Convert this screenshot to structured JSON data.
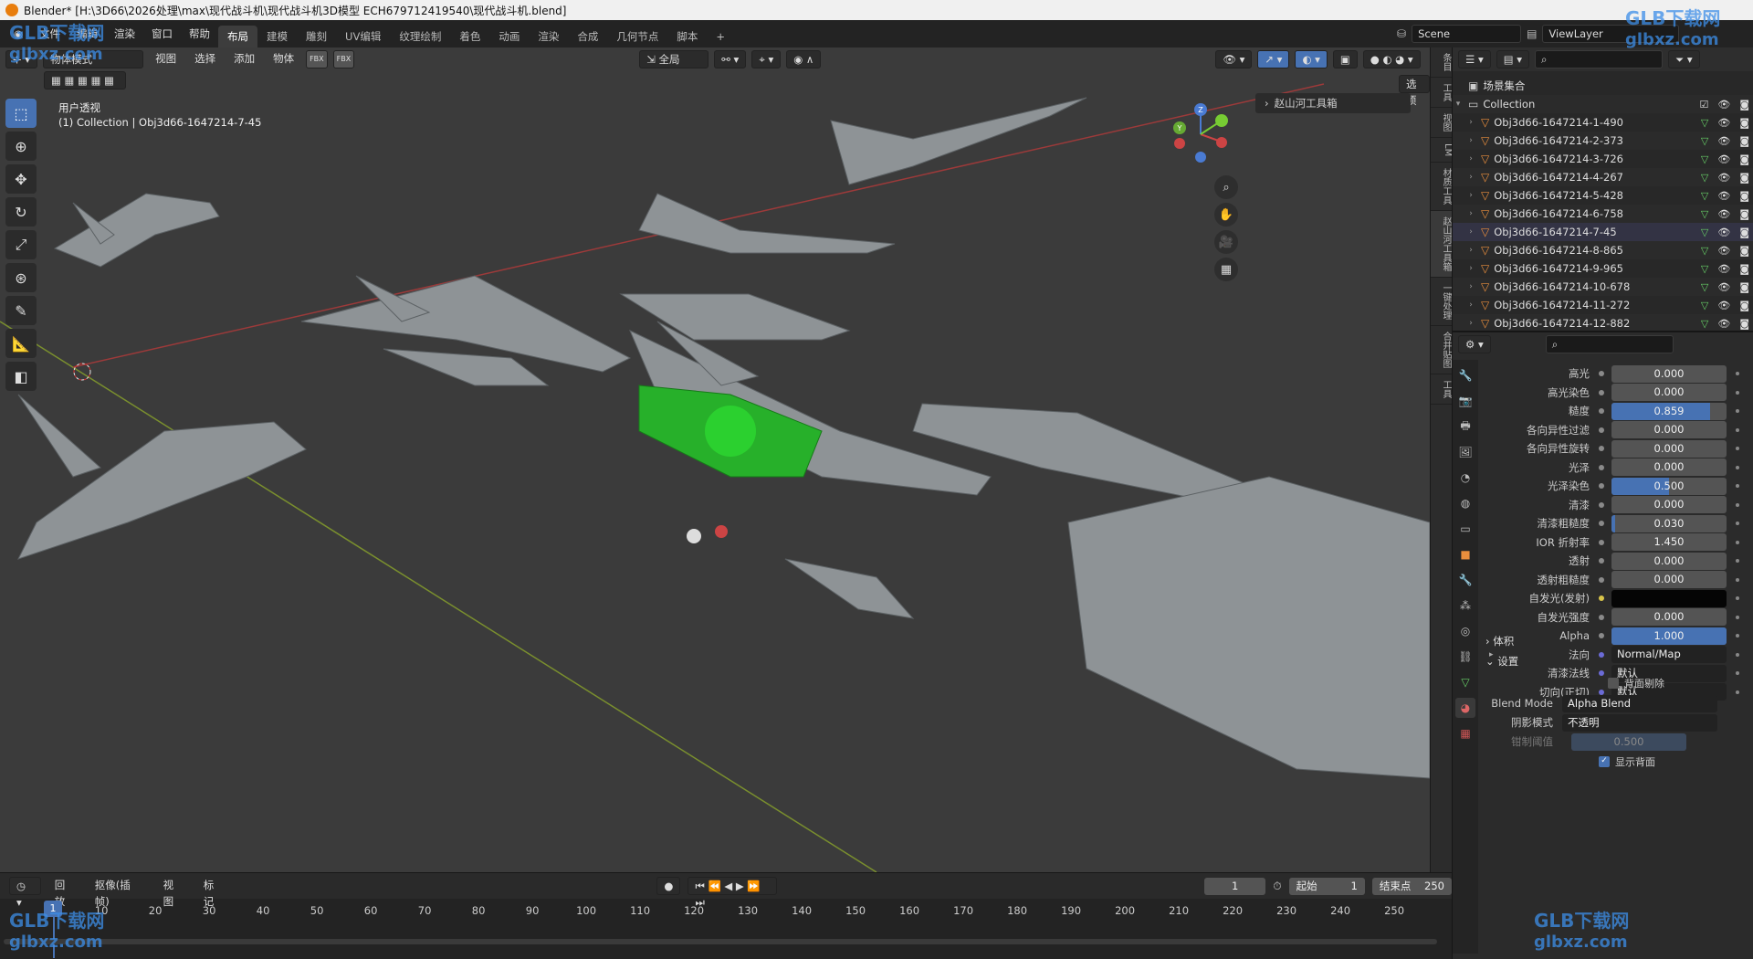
{
  "window": {
    "title": "Blender* [H:\\3D66\\2026处理\\max\\现代战斗机\\现代战斗机3D模型 ECH679712419540\\现代战斗机.blend]"
  },
  "menu": [
    "文件",
    "编辑",
    "渲染",
    "窗口",
    "帮助"
  ],
  "workspaces": [
    "布局",
    "建模",
    "雕刻",
    "UV编辑",
    "纹理绘制",
    "着色",
    "动画",
    "渲染",
    "合成",
    "几何节点",
    "脚本"
  ],
  "workspace_active": "布局",
  "add_tab": "+",
  "scene": {
    "label": "Scene",
    "view_layer": "ViewLayer"
  },
  "viewport": {
    "mode": "物体模式",
    "menus": [
      "视图",
      "选择",
      "添加",
      "物体"
    ],
    "badges": [
      "FBX",
      "FBX"
    ],
    "orientation": "全局",
    "options": "选项",
    "view_name": "用户透视",
    "collection_info": "(1) Collection | Obj3d66-1647214-7-45",
    "toolbox": "赵山河工具箱",
    "gizmo": {
      "x": "X",
      "y": "Y",
      "z": "Z"
    }
  },
  "ntabs": [
    "条目",
    "工具",
    "视图",
    "LM",
    "材质工具",
    "赵山河工具箱",
    "一键处理",
    "合并贴图",
    "工具"
  ],
  "outliner": {
    "root": "场景集合",
    "collection": "Collection",
    "items": [
      "Obj3d66-1647214-1-490",
      "Obj3d66-1647214-2-373",
      "Obj3d66-1647214-3-726",
      "Obj3d66-1647214-4-267",
      "Obj3d66-1647214-5-428",
      "Obj3d66-1647214-6-758",
      "Obj3d66-1647214-7-45",
      "Obj3d66-1647214-8-865",
      "Obj3d66-1647214-9-965",
      "Obj3d66-1647214-10-678",
      "Obj3d66-1647214-11-272",
      "Obj3d66-1647214-12-882"
    ]
  },
  "properties": {
    "rows": [
      {
        "label": "高光",
        "value": "0.000",
        "fill": 0
      },
      {
        "label": "高光染色",
        "value": "0.000",
        "fill": 0
      },
      {
        "label": "糙度",
        "value": "0.859",
        "fill": 0.859
      },
      {
        "label": "各向异性过滤",
        "value": "0.000",
        "fill": 0
      },
      {
        "label": "各向异性旋转",
        "value": "0.000",
        "fill": 0
      },
      {
        "label": "光泽",
        "value": "0.000",
        "fill": 0
      },
      {
        "label": "光泽染色",
        "value": "0.500",
        "fill": 0.5
      },
      {
        "label": "清漆",
        "value": "0.000",
        "fill": 0
      },
      {
        "label": "清漆粗糙度",
        "value": "0.030",
        "fill": 0.03
      },
      {
        "label": "IOR 折射率",
        "value": "1.450",
        "fill": 0
      },
      {
        "label": "透射",
        "value": "0.000",
        "fill": 0
      },
      {
        "label": "透射粗糙度",
        "value": "0.000",
        "fill": 0
      },
      {
        "label": "自发光(发射)",
        "value": "",
        "fill": 0
      },
      {
        "label": "自发光强度",
        "value": "0.000",
        "fill": 0
      },
      {
        "label": "Alpha",
        "value": "1.000",
        "fill": 1
      },
      {
        "label": "法向",
        "value": "Normal/Map",
        "fill": 0
      },
      {
        "label": "清漆法线",
        "value": "默认",
        "fill": 0
      },
      {
        "label": "切向(正切)",
        "value": "默认",
        "fill": 0
      }
    ],
    "volume": "体积",
    "settings": "设置",
    "backface": "背面剔除",
    "blend_mode_label": "Blend Mode",
    "blend_mode": "Alpha Blend",
    "shadow_label": "阴影模式",
    "shadow": "不透明",
    "clip_label": "钳制阈值",
    "clip": "0.500",
    "show_backface": "显示背面"
  },
  "timeline": {
    "menus": [
      "回放",
      "抠像(插帧)",
      "视图",
      "标记"
    ],
    "current": "1",
    "start_label": "起始",
    "start": "1",
    "end_label": "结束点",
    "end": "250",
    "ticks": [
      "10",
      "20",
      "30",
      "40",
      "50",
      "60",
      "70",
      "80",
      "90",
      "100",
      "110",
      "120",
      "130",
      "140",
      "150",
      "160",
      "170",
      "180",
      "190",
      "200",
      "210",
      "220",
      "230",
      "240",
      "250"
    ],
    "playhead": "1"
  },
  "watermarks": {
    "brand": "GLB下载网",
    "site": "glbxz.com"
  }
}
